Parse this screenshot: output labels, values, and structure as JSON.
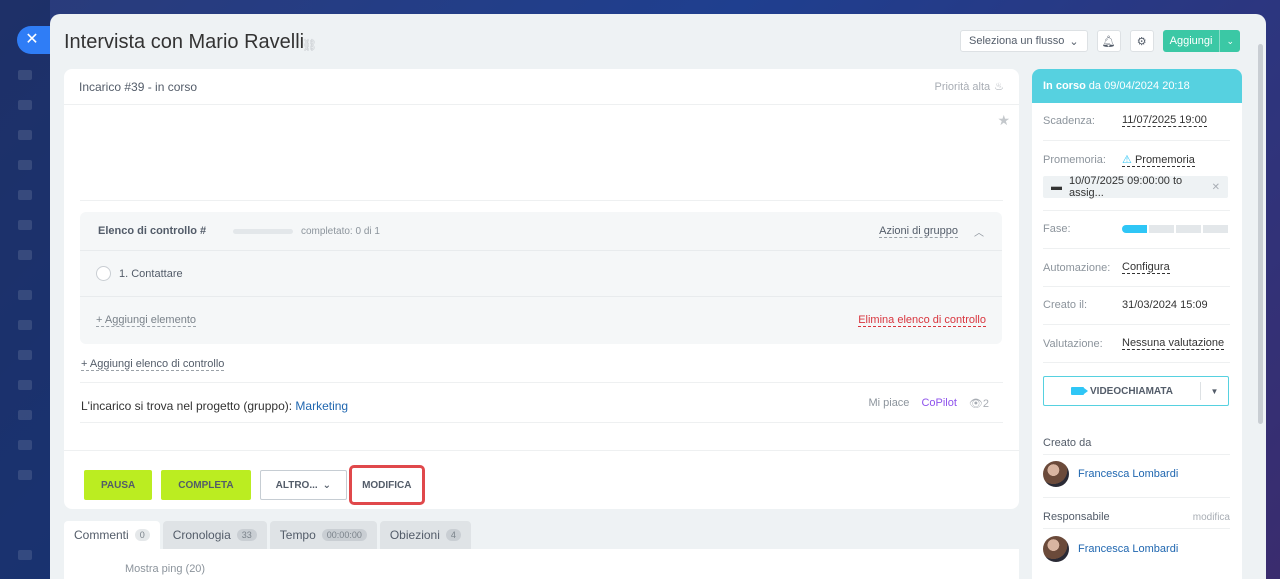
{
  "app": {
    "close_icon": "close-icon",
    "title": "Intervista con Mario Ravelli",
    "link_icon": "link-icon"
  },
  "header": {
    "flow_select": "Seleziona un flusso",
    "bell_icon": "bell-icon",
    "gear_icon": "gear-icon",
    "add_label": "Aggiungi"
  },
  "task": {
    "heading": "Incarico #39 - in corso",
    "priority": "Priorità alta",
    "checklist": {
      "title": "Elenco di controllo #",
      "progress_text": "completato: 0 di 1",
      "progress_fraction": 0,
      "group_actions": "Azioni di gruppo",
      "items": [
        {
          "label": "1. Contattare",
          "checked": false
        }
      ],
      "add_item": "+ Aggiungi elemento",
      "delete": "Elimina elenco di controllo"
    },
    "add_checklist": "+ Aggiungi elenco di controllo",
    "project_prefix": "L'incarico si trova nel progetto (gruppo):",
    "project_name": "Marketing",
    "like": "Mi piace",
    "copilot": "CoPilot",
    "views": "2",
    "buttons": {
      "pause": "PAUSA",
      "complete": "COMPLETA",
      "more": "ALTRO...",
      "modify": "MODIFICA"
    }
  },
  "tabs": [
    {
      "label": "Commenti",
      "count": "0"
    },
    {
      "label": "Cronologia",
      "count": "33"
    },
    {
      "label": "Tempo",
      "count": "00:00:00"
    },
    {
      "label": "Obiezioni",
      "count": "4"
    }
  ],
  "comments": {
    "show_ping": "Mostra ping (20)"
  },
  "side": {
    "status_bold": "In corso",
    "status_rest": "da 09/04/2024 20:18",
    "deadline_label": "Scadenza:",
    "deadline_value": "11/07/2025 19:00",
    "reminder_label": "Promemoria:",
    "reminder_value": "Promemoria",
    "reminder_chip": "10/07/2025 09:00:00 to assig...",
    "stage_label": "Fase:",
    "stage_filled": 1,
    "stage_total": 4,
    "automation_label": "Automazione:",
    "automation_value": "Configura",
    "created_label": "Creato il:",
    "created_value": "31/03/2024 15:09",
    "rating_label": "Valutazione:",
    "rating_value": "Nessuna valutazione",
    "video_call": "VIDEOCHIAMATA",
    "created_by_title": "Creato da",
    "created_by_name": "Francesca Lombardi",
    "responsible_title": "Responsabile",
    "responsible_edit": "modifica",
    "responsible_name": "Francesca Lombardi"
  }
}
